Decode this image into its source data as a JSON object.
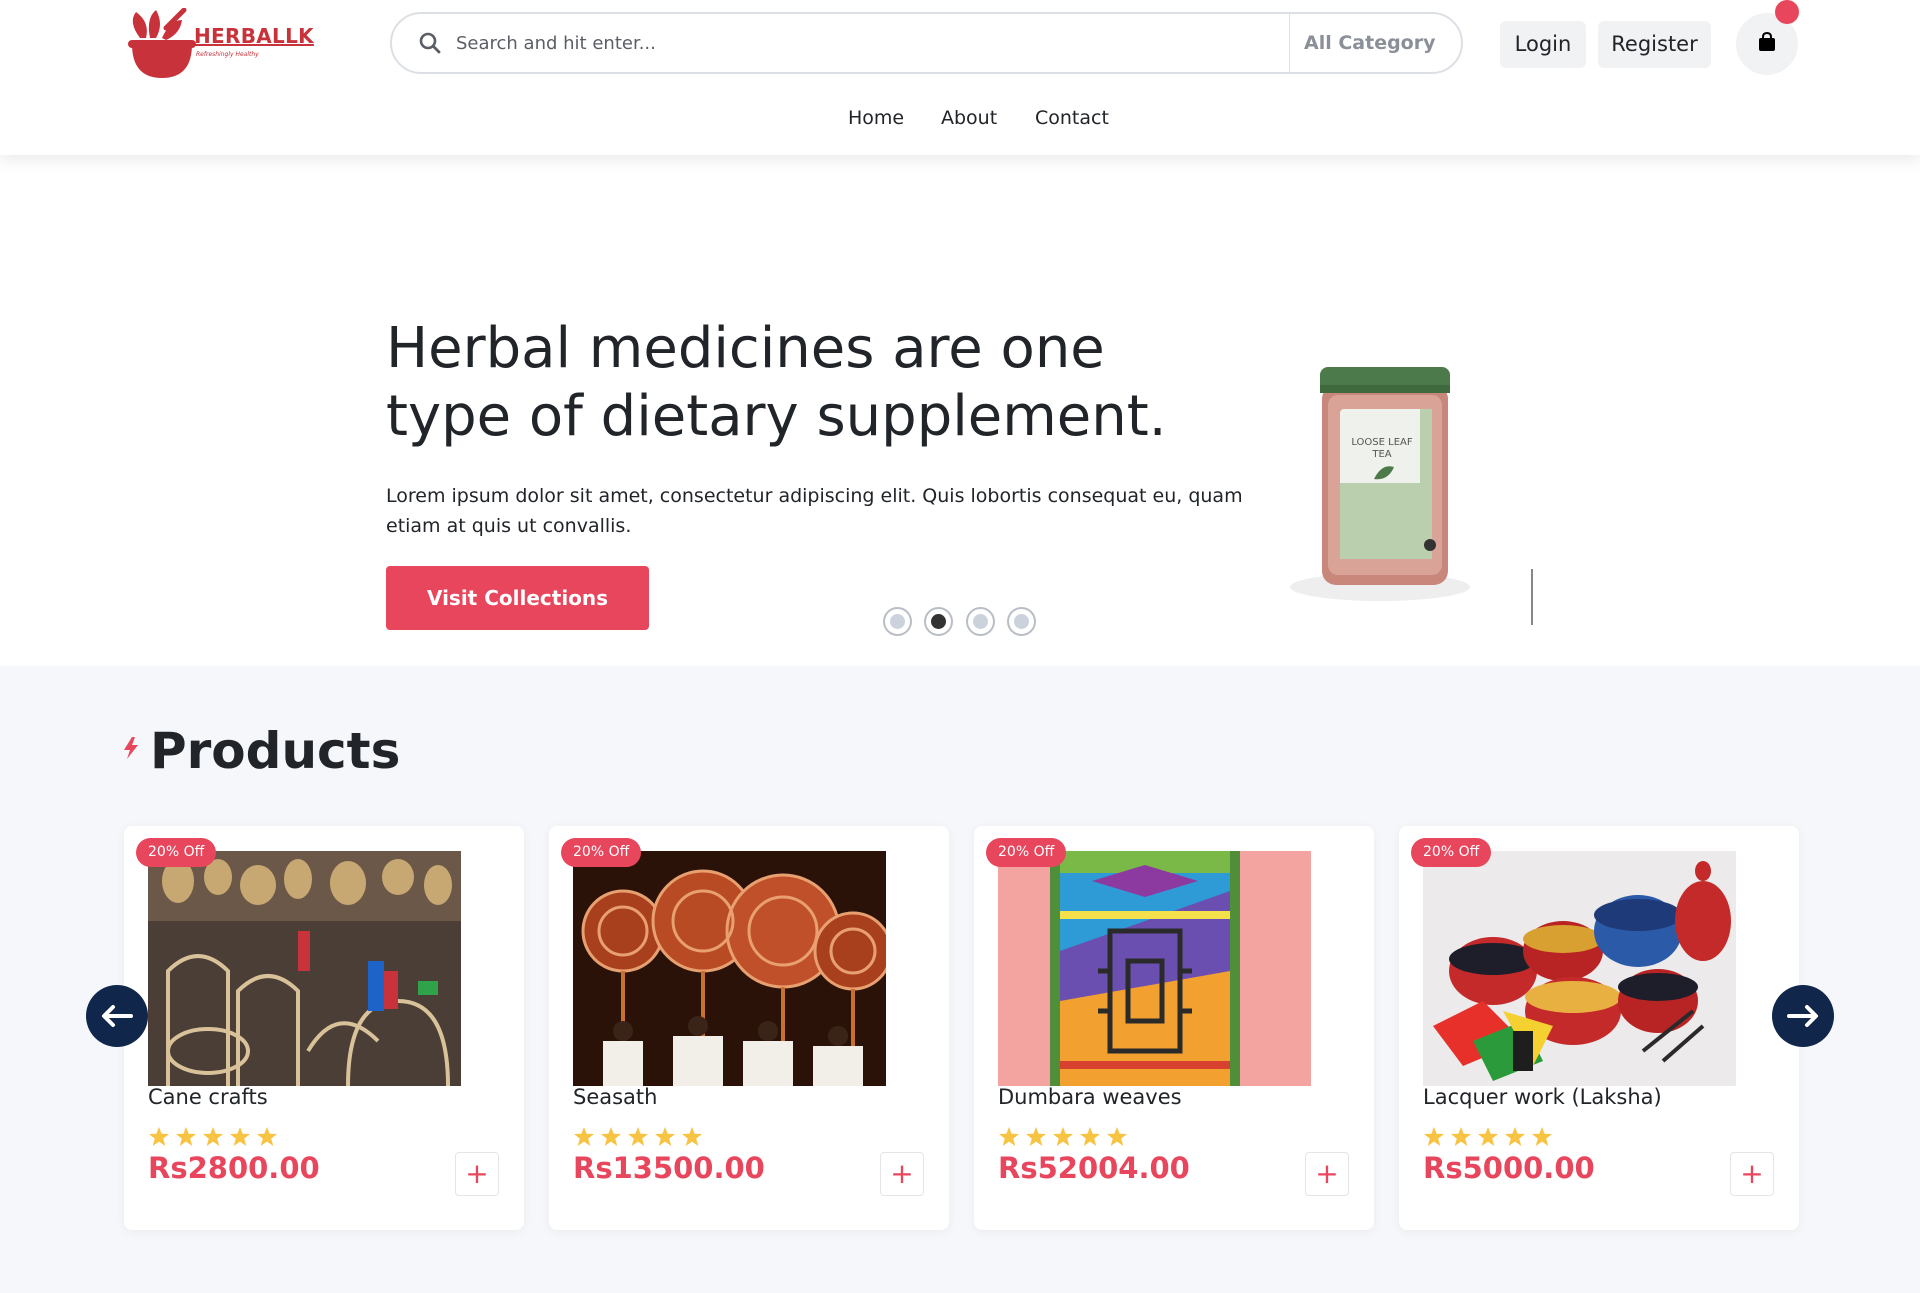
{
  "brand": {
    "name": "HERBALLK",
    "tagline": "Refreshingly Healthy",
    "accent_color": "#c8323a"
  },
  "search": {
    "placeholder": "Search and hit enter...",
    "category": "All Category",
    "icon": "search-icon"
  },
  "header": {
    "login_label": "Login",
    "register_label": "Register",
    "cart_icon": "shopping-bag-icon"
  },
  "nav": {
    "items": [
      {
        "label": "Home"
      },
      {
        "label": "About"
      },
      {
        "label": "Contact"
      }
    ]
  },
  "hero": {
    "title": "Herbal medicines are one type of dietary supplement.",
    "text": "Lorem ipsum dolor sit amet, consectetur adipiscing elit. Quis lobortis consequat eu, quam etiam at quis ut convallis.",
    "button_label": "Visit Collections",
    "active_slide": 2,
    "slide_count": 4,
    "product_label_1": "LOOSE LEAF",
    "product_label_2": "TEA",
    "button_color": "#e8465c"
  },
  "products": {
    "title": "Products",
    "prev_icon": "arrow-left-icon",
    "next_icon": "arrow-right-icon",
    "items": [
      {
        "badge": "20% Off",
        "name": "Cane crafts",
        "rating": 5,
        "price": "Rs2800.00",
        "add_label": "+"
      },
      {
        "badge": "20% Off",
        "name": "Seasath",
        "rating": 5,
        "price": "Rs13500.00",
        "add_label": "+"
      },
      {
        "badge": "20% Off",
        "name": "Dumbara weaves",
        "rating": 5,
        "price": "Rs52004.00",
        "add_label": "+"
      },
      {
        "badge": "20% Off",
        "name": "Lacquer work (Laksha)",
        "rating": 5,
        "price": "Rs5000.00",
        "add_label": "+"
      }
    ]
  },
  "colors": {
    "accent": "#e8465c",
    "navy": "#10264a",
    "star": "#f7c342",
    "section_bg": "#f5f7fa"
  }
}
